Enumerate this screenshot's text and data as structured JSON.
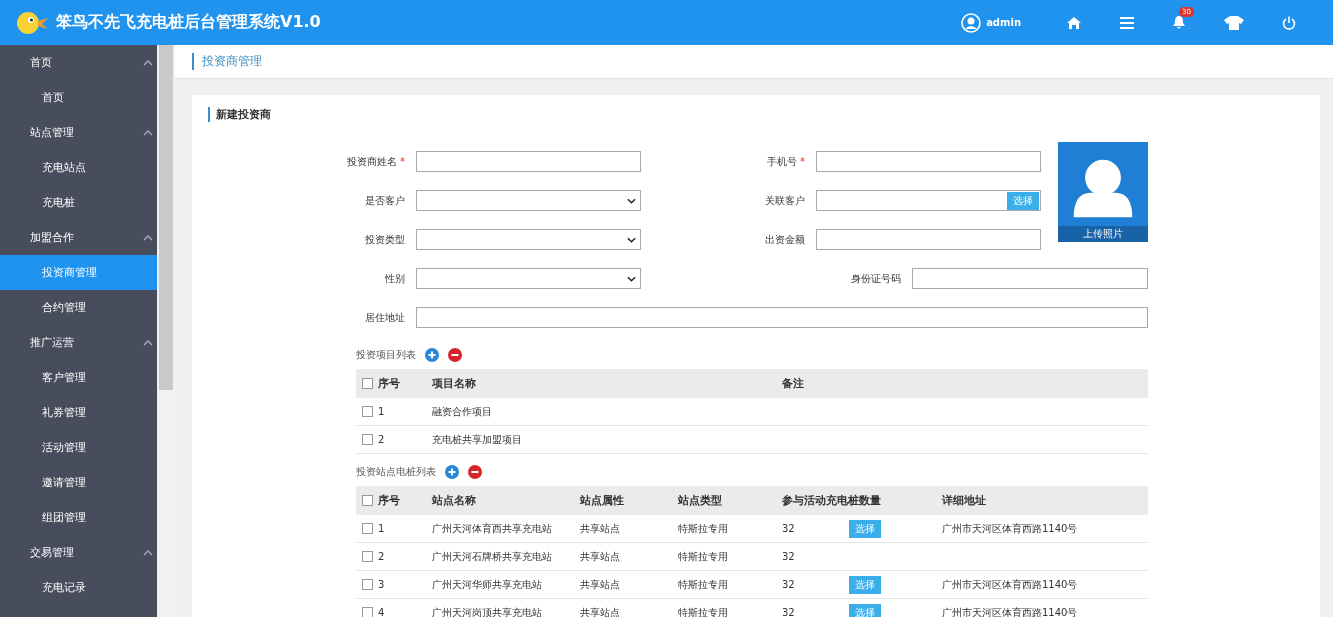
{
  "header": {
    "title": "笨鸟不先飞充电桩后台管理系统V1.0",
    "user": "admin",
    "notification_count": "30"
  },
  "sidebar": {
    "groups": [
      {
        "label": "首页",
        "expanded": true,
        "children": [
          {
            "label": "首页",
            "selected": false
          }
        ]
      },
      {
        "label": "站点管理",
        "expanded": true,
        "children": [
          {
            "label": "充电站点",
            "selected": false
          },
          {
            "label": "充电桩",
            "selected": false
          }
        ]
      },
      {
        "label": "加盟合作",
        "expanded": true,
        "children": [
          {
            "label": "投资商管理",
            "selected": true
          },
          {
            "label": "合约管理",
            "selected": false
          }
        ]
      },
      {
        "label": "推广运营",
        "expanded": true,
        "children": [
          {
            "label": "客户管理",
            "selected": false
          },
          {
            "label": "礼券管理",
            "selected": false
          },
          {
            "label": "活动管理",
            "selected": false
          },
          {
            "label": "邀请管理",
            "selected": false
          },
          {
            "label": "组团管理",
            "selected": false
          }
        ]
      },
      {
        "label": "交易管理",
        "expanded": true,
        "children": [
          {
            "label": "充电记录",
            "selected": false
          }
        ]
      }
    ]
  },
  "breadcrumb": "投资商管理",
  "card_title": "新建投资商",
  "form": {
    "rows": [
      [
        {
          "label": "投资商姓名",
          "mark": "*",
          "kind": "text"
        },
        {
          "label": "手机号",
          "mark": "*",
          "kind": "text"
        }
      ],
      [
        {
          "label": "是否客户",
          "kind": "select"
        },
        {
          "label": "关联客户",
          "kind": "pick",
          "button": "选择"
        }
      ],
      [
        {
          "label": "投资类型",
          "kind": "select"
        },
        {
          "label": "出资金额",
          "kind": "text"
        }
      ]
    ],
    "photo_label": "上传照片",
    "gender": {
      "label": "性别",
      "kind": "select"
    },
    "id_number": {
      "label": "身份证号码"
    },
    "address": {
      "label": "居住地址"
    }
  },
  "projects": {
    "title": "投资项目列表",
    "all_checked": false,
    "columns": [
      "序号",
      "项目名称",
      "备注"
    ],
    "rows": [
      {
        "checked": false,
        "cells": [
          "1",
          "融资合作项目"
        ]
      },
      {
        "checked": false,
        "cells": [
          "2",
          "充电桩共享加盟项目"
        ]
      }
    ]
  },
  "stations": {
    "title": "投资站点电桩列表",
    "all_checked": false,
    "columns": [
      "序号",
      "站点名称",
      "站点属性",
      "站点类型",
      "参与活动充电桩数量",
      "详细地址"
    ],
    "rows": [
      {
        "checked": false,
        "cells": [
          "1",
          "广州天河体育西共享充电站",
          "共享站点",
          "特斯拉专用",
          "32"
        ],
        "action": "选择",
        "address": "广州市天河区体育西路1140号"
      },
      {
        "checked": false,
        "cells": [
          "2",
          "广州天河石牌桥共享充电站",
          "共享站点",
          "特斯拉专用",
          "32"
        ]
      },
      {
        "checked": false,
        "cells": [
          "3",
          "广州天河华师共享充电站",
          "共享站点",
          "特斯拉专用",
          "32"
        ],
        "action": "选择",
        "address": "广州市天河区体育西路1140号"
      },
      {
        "checked": false,
        "cells": [
          "4",
          "广州天河岗顶共享充电站",
          "共享站点",
          "特斯拉专用",
          "32"
        ],
        "action": "选择",
        "address": "广州市天河区体育西路1140号"
      }
    ]
  }
}
